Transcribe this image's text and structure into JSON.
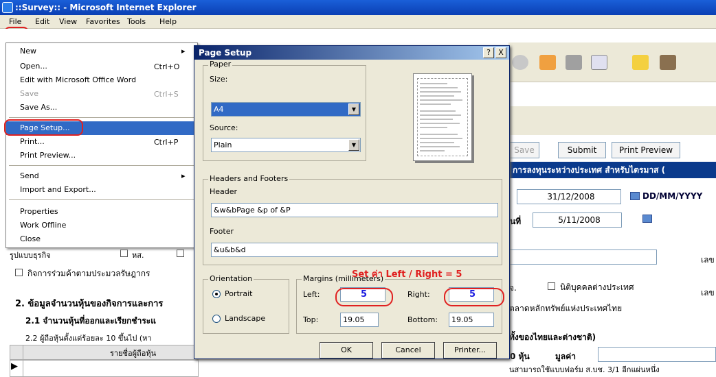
{
  "window": {
    "title": "::Survey:: - Microsoft Internet Explorer"
  },
  "menubar": {
    "items": [
      "File",
      "Edit",
      "View",
      "Favorites",
      "Tools",
      "Help"
    ]
  },
  "file_menu": {
    "items": [
      {
        "label": "New",
        "shortcut": "",
        "submenu": true
      },
      {
        "label": "Open...",
        "shortcut": "Ctrl+O"
      },
      {
        "label": "Edit with Microsoft Office Word",
        "shortcut": ""
      },
      {
        "label": "Save",
        "shortcut": "Ctrl+S",
        "disabled": true
      },
      {
        "label": "Save As...",
        "shortcut": ""
      },
      {
        "label": "Page Setup...",
        "shortcut": "",
        "highlighted": true
      },
      {
        "label": "Print...",
        "shortcut": "Ctrl+P"
      },
      {
        "label": "Print Preview...",
        "shortcut": ""
      },
      {
        "label": "Send",
        "shortcut": "",
        "submenu": true
      },
      {
        "label": "Import and Export...",
        "shortcut": ""
      },
      {
        "label": "Properties",
        "shortcut": ""
      },
      {
        "label": "Work Offline",
        "shortcut": ""
      },
      {
        "label": "Close",
        "shortcut": ""
      }
    ]
  },
  "dialog": {
    "title": "Page Setup",
    "help_btn": "?",
    "close_btn": "X",
    "paper": {
      "group_label": "Paper",
      "size_label": "Size:",
      "size_value": "A4",
      "source_label": "Source:",
      "source_value": "Plain"
    },
    "headers_footers": {
      "group_label": "Headers and Footers",
      "header_label": "Header",
      "header_value": "&w&bPage &p of &P",
      "footer_label": "Footer",
      "footer_value": "&u&b&d"
    },
    "orientation": {
      "group_label": "Orientation",
      "portrait": "Portrait",
      "landscape": "Landscape",
      "selected": "Portrait"
    },
    "margins": {
      "group_label": "Margins (millimeters)",
      "left_label": "Left:",
      "left_value": "5",
      "right_label": "Right:",
      "right_value": "5",
      "top_label": "Top:",
      "top_value": "19.05",
      "bottom_label": "Bottom:",
      "bottom_value": "19.05"
    },
    "buttons": {
      "ok": "OK",
      "cancel": "Cancel",
      "printer": "Printer..."
    }
  },
  "annotation": {
    "text": "Set ค่า Left / Right  = 5"
  },
  "page": {
    "buttons": {
      "save": "Save",
      "submit": "Submit",
      "print_preview": "Print Preview"
    },
    "banner": "การลงทุนระหว่างประเทศ สำหรับไตรมาส (",
    "date1": "31/12/2008",
    "date_format": "DD/MM/YYYY",
    "date2_label": "นที่",
    "date2": "5/11/2008",
    "row_label_business": "รูปแบบธุรกิจ",
    "chk_label_1": "หส.",
    "right_label_1": "เลข",
    "chk_joint": "กิจการร่วมค้าตามประมวลรัษฎากร",
    "chk_foreign_juristic": "นิติบุคคลต่างประเทศ",
    "right_label_2": "เลข",
    "abbr_1": "จ.",
    "stock_exchange": "ตลาดหลักทรัพย์แห่งประเทศไทย",
    "section2": "2. ข้อมูลจำนวนหุ้นของกิจการและการ",
    "section21": "2.1 จำนวนหุ้นที่ออกและเรียกชำระแ",
    "section22": "2.2 ผู้ถือหุ้นตั้งแต่ร้อยละ 10 ขึ้นไป (หา",
    "section22_right": "ทั้งของไทยและต่างชาติ)",
    "table_header": "รายชื่อผู้ถือหุ้น",
    "shares_unit": "0 หุ้น",
    "value_label": "มูลค่า",
    "bottom_text": "นสามารถใช้แบบฟอร์ม ส.บช. 3/1 อีกแผ่นหนึ่ง"
  }
}
